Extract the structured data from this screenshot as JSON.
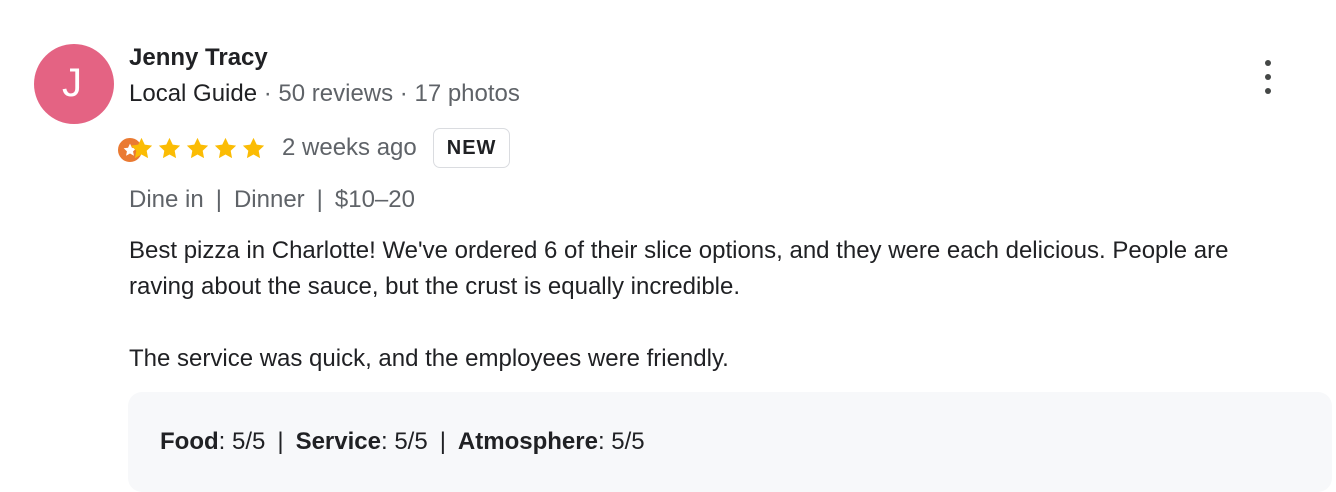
{
  "author": {
    "initial": "J",
    "name": "Jenny Tracy",
    "badge": "Local Guide",
    "meta_sep_1": " · ",
    "reviews": "50 reviews",
    "meta_sep_2": " · ",
    "photos": "17 photos",
    "avatar_color": "#e46383",
    "badge_color": "#ea7a32"
  },
  "review": {
    "rating": 5,
    "rating_max": 5,
    "star_color": "#fbbc04",
    "time": "2 weeks ago",
    "new_label": "NEW",
    "tags": [
      "Dine in",
      "Dinner",
      "$10–20"
    ],
    "tag_separator": "|",
    "paragraph_1_line_1": "Best pizza in Charlotte! We've ordered 6 of their slice options, and they were each delicious. People are",
    "paragraph_1_line_2": "raving about the sauce, but the crust is equally incredible.",
    "paragraph_2": "The service was quick, and the employees were friendly."
  },
  "subratings": {
    "separator": "|",
    "items": [
      {
        "label": "Food",
        "value": ": 5/5"
      },
      {
        "label": "Service",
        "value": ": 5/5"
      },
      {
        "label": "Atmosphere",
        "value": ": 5/5"
      }
    ]
  },
  "icons": {
    "more": "more-vert-icon",
    "guide": "local-guide-star-icon",
    "star": "star-icon"
  }
}
